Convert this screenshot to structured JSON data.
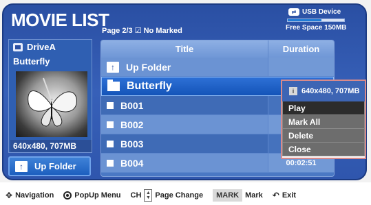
{
  "header": {
    "title": "MOVIE LIST",
    "page_info": "Page 2/3 ☑ No Marked"
  },
  "usb": {
    "device_label": "USB Device",
    "free_space": "Free Space 150MB",
    "usage_fraction": 0.6,
    "icon": "usb-icon"
  },
  "preview": {
    "drive": "DriveA",
    "name": "Butterfly",
    "resolution": "640x480, 707MB"
  },
  "up_folder_button": {
    "label": "Up Folder"
  },
  "list": {
    "columns": {
      "title": "Title",
      "duration": "Duration"
    },
    "rows": [
      {
        "type": "up-folder",
        "title": "Up Folder",
        "duration": ""
      },
      {
        "type": "folder",
        "title": "Butterfly",
        "duration": "",
        "selected": true
      },
      {
        "type": "file",
        "title": "B001",
        "duration": ""
      },
      {
        "type": "file",
        "title": "B002",
        "duration": ""
      },
      {
        "type": "file",
        "title": "B003",
        "duration": ""
      },
      {
        "type": "file",
        "title": "B004",
        "duration": "00:02:51"
      }
    ]
  },
  "popup": {
    "info": "640x480,  707MB",
    "items": [
      "Play",
      "Mark All",
      "Delete",
      "Close"
    ],
    "active_index": 0
  },
  "footer": {
    "navigation": "Navigation",
    "popup_menu": "PopUp Menu",
    "ch_key": "CH",
    "page_change": "Page Change",
    "mark_key": "MARK",
    "mark": "Mark",
    "exit": "Exit"
  },
  "colors": {
    "frame": "#2a4fa3",
    "selected_row": "#1454b8",
    "popup_border": "#d98a8a",
    "menu_active": "#2c2c2c"
  }
}
